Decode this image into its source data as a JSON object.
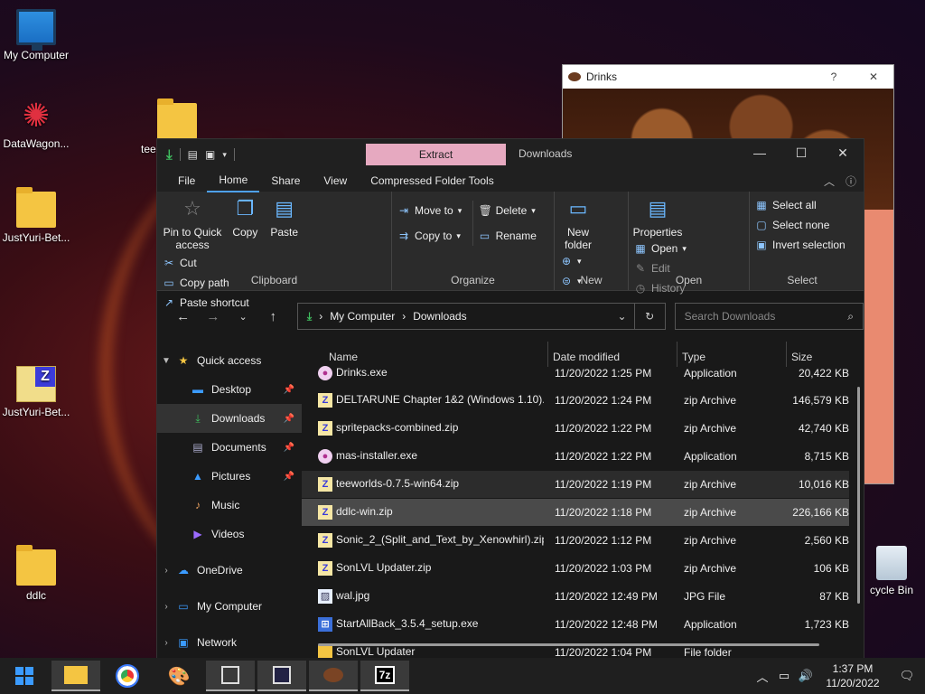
{
  "desktop": {
    "icons": [
      {
        "label": "My Computer"
      },
      {
        "label": "DataWagon..."
      },
      {
        "label": "JustYuri-Bet..."
      },
      {
        "label": "JustYuri-Bet..."
      },
      {
        "label": "ddlc"
      },
      {
        "label": "tee"
      },
      {
        "label": "cycle Bin"
      }
    ]
  },
  "drinks_window": {
    "title": "Drinks",
    "help": "?",
    "close": "✕"
  },
  "explorer": {
    "extract_tab": "Extract",
    "title": "Downloads",
    "controls": {
      "minimize": "—",
      "maximize": "☐",
      "close": "✕"
    },
    "menu": [
      "File",
      "Home",
      "Share",
      "View",
      "Compressed Folder Tools"
    ],
    "ribbon": {
      "clipboard": {
        "label": "Clipboard",
        "pin": "Pin to Quick access",
        "copy": "Copy",
        "paste": "Paste",
        "cut": "Cut",
        "copy_path": "Copy path",
        "paste_shortcut": "Paste shortcut"
      },
      "organize": {
        "label": "Organize",
        "move_to": "Move to",
        "copy_to": "Copy to",
        "delete": "Delete",
        "rename": "Rename"
      },
      "new": {
        "label": "New",
        "new_folder": "New folder"
      },
      "open": {
        "label": "Open",
        "properties": "Properties",
        "open": "Open",
        "edit": "Edit",
        "history": "History"
      },
      "select": {
        "label": "Select",
        "select_all": "Select all",
        "select_none": "Select none",
        "invert": "Invert selection"
      }
    },
    "address": {
      "root": "My Computer",
      "folder": "Downloads"
    },
    "search_placeholder": "Search Downloads",
    "nav_pane": [
      {
        "label": "Quick access",
        "icon": "star-icon"
      },
      {
        "label": "Desktop",
        "icon": "desktop-icon"
      },
      {
        "label": "Downloads",
        "icon": "download-icon"
      },
      {
        "label": "Documents",
        "icon": "documents-icon"
      },
      {
        "label": "Pictures",
        "icon": "pictures-icon"
      },
      {
        "label": "Music",
        "icon": "music-icon"
      },
      {
        "label": "Videos",
        "icon": "videos-icon"
      },
      {
        "label": "OneDrive",
        "icon": "cloud-icon"
      },
      {
        "label": "My Computer",
        "icon": "computer-icon"
      },
      {
        "label": "Network",
        "icon": "network-icon"
      }
    ],
    "columns": [
      "Name",
      "Date modified",
      "Type",
      "Size"
    ],
    "files": [
      {
        "name": "Drinks.exe",
        "date": "11/20/2022 1:25 PM",
        "type": "Application",
        "size": "20,422 KB",
        "kind": "exe"
      },
      {
        "name": "DELTARUNE Chapter 1&2 (Windows 1.10)...",
        "date": "11/20/2022 1:24 PM",
        "type": "zip Archive",
        "size": "146,579 KB",
        "kind": "zip"
      },
      {
        "name": "spritepacks-combined.zip",
        "date": "11/20/2022 1:22 PM",
        "type": "zip Archive",
        "size": "42,740 KB",
        "kind": "zip"
      },
      {
        "name": "mas-installer.exe",
        "date": "11/20/2022 1:22 PM",
        "type": "Application",
        "size": "8,715 KB",
        "kind": "exe"
      },
      {
        "name": "teeworlds-0.7.5-win64.zip",
        "date": "11/20/2022 1:19 PM",
        "type": "zip Archive",
        "size": "10,016 KB",
        "kind": "zip"
      },
      {
        "name": "ddlc-win.zip",
        "date": "11/20/2022 1:18 PM",
        "type": "zip Archive",
        "size": "226,166 KB",
        "kind": "zip"
      },
      {
        "name": "Sonic_2_(Split_and_Text_by_Xenowhirl).zip",
        "date": "11/20/2022 1:12 PM",
        "type": "zip Archive",
        "size": "2,560 KB",
        "kind": "zip"
      },
      {
        "name": "SonLVL Updater.zip",
        "date": "11/20/2022 1:03 PM",
        "type": "zip Archive",
        "size": "106 KB",
        "kind": "zip"
      },
      {
        "name": "wal.jpg",
        "date": "11/20/2022 12:49 PM",
        "type": "JPG File",
        "size": "87 KB",
        "kind": "jpg"
      },
      {
        "name": "StartAllBack_3.5.4_setup.exe",
        "date": "11/20/2022 12:48 PM",
        "type": "Application",
        "size": "1,723 KB",
        "kind": "setup"
      },
      {
        "name": "SonLVL Updater",
        "date": "11/20/2022 1:04 PM",
        "type": "File folder",
        "size": "",
        "kind": "fold"
      }
    ]
  },
  "taskbar": {
    "time": "1:37 PM",
    "date": "11/20/2022"
  }
}
